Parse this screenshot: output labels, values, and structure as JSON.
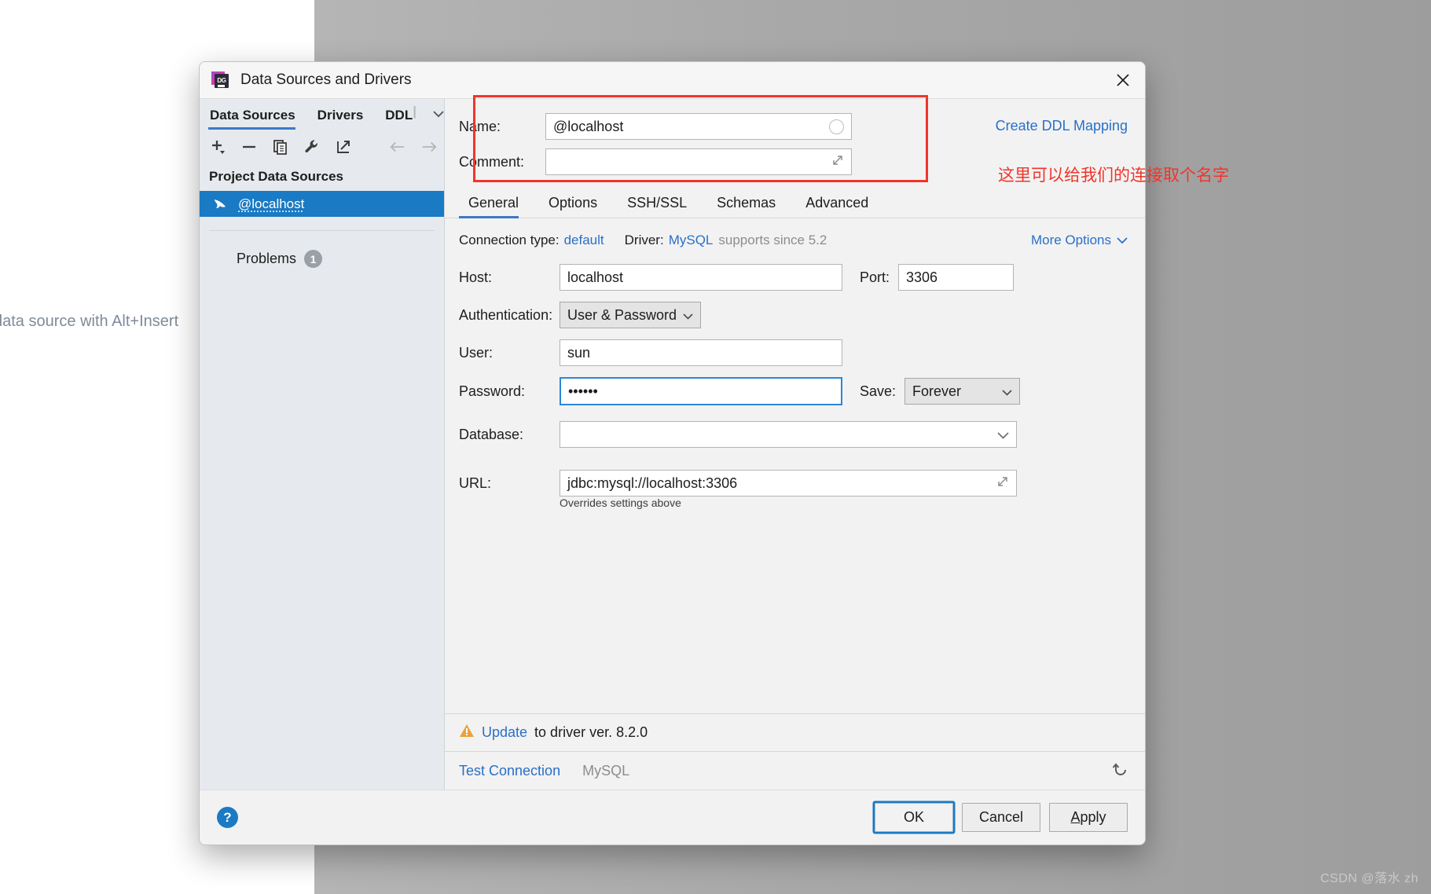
{
  "desktop": {
    "background_hint": "data source with Alt+Insert",
    "watermark": "CSDN @落水 zh"
  },
  "dialog": {
    "title": "Data Sources and Drivers",
    "close_icon": "close-icon"
  },
  "left_pane": {
    "tabs": [
      {
        "label": "Data Sources",
        "active": true
      },
      {
        "label": "Drivers",
        "active": false
      },
      {
        "label": "DDL",
        "active": false,
        "truncated": true
      }
    ],
    "tab_overflow_icon": "chevron-down-icon",
    "toolbar": [
      {
        "name": "add-data-source-button",
        "icon": "plus-icon"
      },
      {
        "name": "remove-data-source-button",
        "icon": "minus-icon"
      },
      {
        "name": "duplicate-button",
        "icon": "copy-icon"
      },
      {
        "name": "driver-properties-button",
        "icon": "wrench-icon"
      },
      {
        "name": "share-button",
        "icon": "external-link-icon"
      }
    ],
    "nav": [
      {
        "name": "navigate-back-button",
        "icon": "arrow-left-icon"
      },
      {
        "name": "navigate-forward-button",
        "icon": "arrow-right-icon"
      }
    ],
    "section_title": "Project Data Sources",
    "data_source": {
      "label": "@localhost",
      "icon": "mysql-dolphin-icon",
      "selected": true
    },
    "problems": {
      "label": "Problems",
      "count": "1"
    }
  },
  "header_form": {
    "name_label": "Name:",
    "name_value": "@localhost",
    "name_indicator": "circle-indicator",
    "comment_label": "Comment:",
    "comment_value": "",
    "comment_expand_icon": "expand-icon",
    "create_ddl_mapping": "Create DDL Mapping"
  },
  "tabs": [
    {
      "label": "General",
      "active": true
    },
    {
      "label": "Options",
      "active": false
    },
    {
      "label": "SSH/SSL",
      "active": false
    },
    {
      "label": "Schemas",
      "active": false
    },
    {
      "label": "Advanced",
      "active": false
    }
  ],
  "general": {
    "connection_type_label": "Connection type:",
    "connection_type_value": "default",
    "driver_label": "Driver:",
    "driver_value": "MySQL",
    "driver_note": "supports since 5.2",
    "more_options": "More Options",
    "more_options_icon": "chevron-down-icon",
    "host_label": "Host:",
    "host_value": "localhost",
    "port_label": "Port:",
    "port_value": "3306",
    "authentication_label": "Authentication:",
    "authentication_value": "User & Password",
    "user_label": "User:",
    "user_value": "sun",
    "password_label": "Password:",
    "password_value": "••••••",
    "save_label": "Save:",
    "save_value": "Forever",
    "database_label": "Database:",
    "database_value": "",
    "url_label": "URL:",
    "url_value": "jdbc:mysql://localhost:3306",
    "url_expand_icon": "expand-icon",
    "url_hint": "Overrides settings above"
  },
  "status": {
    "warning_icon": "warning-triangle-icon",
    "update_link": "Update",
    "update_text": "to driver ver. 8.2.0",
    "test_connection": "Test Connection",
    "driver_name": "MySQL",
    "revert_icon": "revert-icon"
  },
  "footer": {
    "help_label": "?",
    "ok_label": "OK",
    "cancel_label": "Cancel",
    "apply_label_first": "A",
    "apply_label_rest": "pply"
  },
  "annotation": {
    "text": "这里可以给我们的连接取个名字",
    "color": "#f0352b"
  },
  "colors": {
    "accent_blue": "#2a6fc9",
    "selection_blue": "#1a7ac4",
    "tab_underline": "#3d78c8",
    "sidebar_bg": "#e6eaee",
    "dialog_bg": "#f2f2f2",
    "warning_amber": "#e8a33d"
  }
}
